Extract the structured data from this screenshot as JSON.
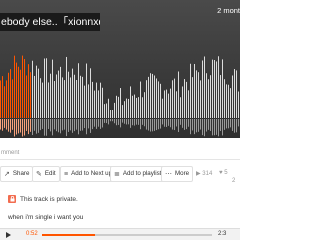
{
  "hero": {
    "title": "ebody else..「xionnxd」",
    "posted_ago": "2 mont"
  },
  "waveform": {
    "played_fraction": 0.13,
    "played_color": "#ff5500",
    "unplayed_color": "#dcdcdc"
  },
  "comment": {
    "placeholder": "mment"
  },
  "actions": {
    "share": "Share",
    "edit": "Edit",
    "add_next": "Add to Next up",
    "add_playlist": "Add to playlist",
    "more": "More",
    "plays": "314",
    "likes": "5",
    "reposts": "2"
  },
  "notice": {
    "text": "This track is private."
  },
  "description": "when i'm single i want you",
  "player": {
    "elapsed": "0:52",
    "total": "2:3",
    "progress": 0.31,
    "accent": "#ff5500"
  }
}
